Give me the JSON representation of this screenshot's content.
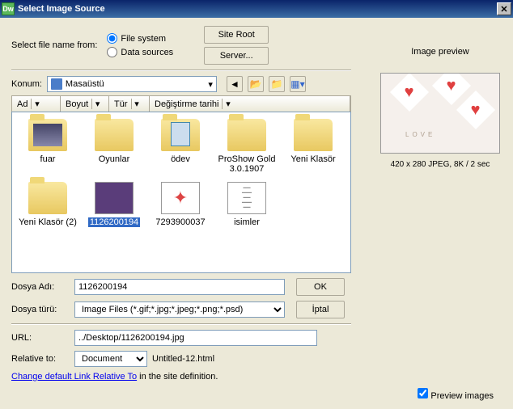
{
  "title": "Select Image Source",
  "topLabel": "Select file name from:",
  "radio1": "File system",
  "radio2": "Data sources",
  "btnSiteRoot": "Site Root",
  "btnServer": "Server...",
  "locLabel": "Konum:",
  "locValue": "Masaüstü",
  "columns": {
    "c1": "Ad",
    "c2": "Boyut",
    "c3": "Tür",
    "c4": "Değiştirme tarihi"
  },
  "items": [
    {
      "name": "fuar",
      "type": "folder-img"
    },
    {
      "name": "Oyunlar",
      "type": "folder"
    },
    {
      "name": "ödev",
      "type": "folder-doc"
    },
    {
      "name": "ProShow Gold 3.0.1907",
      "type": "folder"
    },
    {
      "name": "Yeni Klasör",
      "type": "folder"
    },
    {
      "name": "Yeni Klasör (2)",
      "type": "folder"
    },
    {
      "name": "1126200194",
      "type": "thumb-purple",
      "selected": true
    },
    {
      "name": "7293900037",
      "type": "thumb-fire"
    },
    {
      "name": "isimler",
      "type": "thumb-text"
    }
  ],
  "fileNameLbl": "Dosya Adı:",
  "fileNameVal": "1126200194",
  "fileTypeLbl": "Dosya türü:",
  "fileTypeVal": "Image Files (*.gif;*.jpg;*.jpeg;*.png;*.psd)",
  "okBtn": "OK",
  "cancelBtn": "İptal",
  "urlLbl": "URL:",
  "urlVal": "../Desktop/1126200194.jpg",
  "relLbl": "Relative to:",
  "relVal": "Document",
  "relFile": "Untitled-12.html",
  "changeLink": "Change default Link Relative To",
  "changeRest": " in the site definition.",
  "previewTitle": "Image preview",
  "previewInfo": "420 x 280 JPEG, 8K / 2 sec",
  "previewCheck": "Preview images"
}
